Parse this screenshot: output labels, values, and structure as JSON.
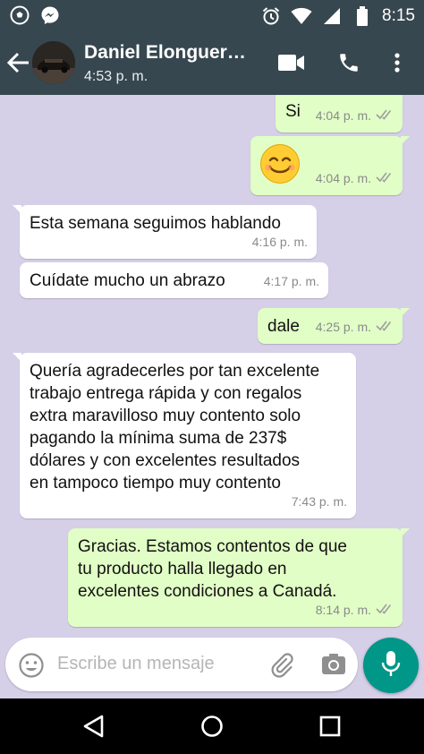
{
  "status_bar": {
    "time": "8:15",
    "icons": [
      "soccer-ball-icon",
      "messenger-icon",
      "alarm-icon",
      "wifi-icon",
      "signal-icon",
      "battery-icon"
    ]
  },
  "header": {
    "contact_name": "Daniel Elonguer…",
    "last_seen": "4:53 p. m.",
    "icons": [
      "back-arrow-icon",
      "video-call-icon",
      "phone-icon",
      "more-vert-icon"
    ]
  },
  "messages": [
    {
      "direction": "out",
      "text": "Si",
      "time": "4:04 p. m.",
      "read": true
    },
    {
      "direction": "out",
      "emoji": "smiling-face-icon",
      "text": "",
      "time": "4:04 p. m.",
      "read": true
    },
    {
      "direction": "in",
      "text": "Esta semana seguimos hablando",
      "time": "4:16 p. m."
    },
    {
      "direction": "in",
      "text": "Cuídate mucho un abrazo",
      "time": "4:17 p. m."
    },
    {
      "direction": "out",
      "text": "dale",
      "time": "4:25 p. m.",
      "read": true
    },
    {
      "direction": "in",
      "text": "Quería agradecerles por tan excelente\ntrabajo entrega rápida y con regalos\nextra maravilloso muy contento solo\npagando la mínima suma de 237$\ndólares y con excelentes resultados\nen tampoco tiempo muy contento",
      "time": "7:43 p. m."
    },
    {
      "direction": "out",
      "text": "Gracias. Estamos contentos de que\ntu producto halla llegado en\nexcelentes condiciones a Canadá.",
      "time": "8:14 p. m.",
      "read": true
    }
  ],
  "composer": {
    "placeholder": "Escribe un mensaje"
  },
  "colors": {
    "toolbar": "#37474f",
    "chat_background": "#d6cfe8",
    "outgoing_bubble": "#e1fec6",
    "incoming_bubble": "#ffffff",
    "read_ticks": "#4fc3f7",
    "mic_button": "#009688"
  }
}
